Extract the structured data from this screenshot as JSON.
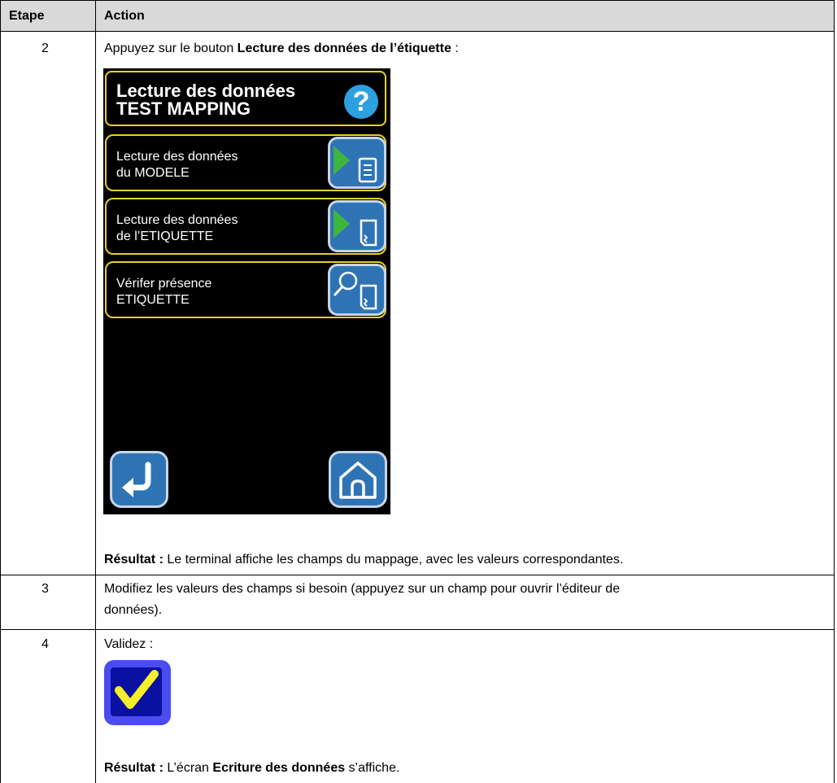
{
  "table": {
    "headers": [
      "Etape",
      "Action"
    ],
    "rows": [
      {
        "step": "2",
        "instruction_prefix": "Appuyez sur le bouton ",
        "instruction_bold": "Lecture des données de l’étiquette",
        "instruction_suffix": " :",
        "result_label": "Résultat :",
        "result_text": " Le terminal affiche les champs du mappage, avec les valeurs correspondantes."
      },
      {
        "step": "3",
        "line1": "Modifiez les valeurs des champs si besoin (appuyez sur un champ pour ouvrir l’éditeur de",
        "line2": "données)."
      },
      {
        "step": "4",
        "instruction": "Validez :",
        "result_label": "Résultat :",
        "result_prefix": " L’écran ",
        "result_bold": "Ecriture des données",
        "result_suffix": " s’affiche."
      }
    ]
  },
  "device": {
    "title_line1": "Lecture des données",
    "title_line2": "TEST MAPPING",
    "help_symbol": "?",
    "menu": [
      {
        "line1": "Lecture des données",
        "line2": "du MODELE",
        "icon": "read-model-icon"
      },
      {
        "line1": "Lecture des données",
        "line2": "de l’ETIQUETTE",
        "icon": "read-tag-icon"
      },
      {
        "line1": "Vérifer présence",
        "line2": "ETIQUETTE",
        "icon": "check-tag-presence-icon"
      }
    ],
    "nav": {
      "back_icon": "back-arrow-icon",
      "home_icon": "home-icon"
    },
    "colors": {
      "frame": "#e8d21a",
      "button": "#2e74b5",
      "play": "#3fb43f",
      "help": "#2da0e0"
    }
  },
  "validate_icon": {
    "name": "validate-check-icon",
    "colors": {
      "outer": "#4a4cf0",
      "inner": "#0a10a0",
      "check": "#f5ef2a"
    }
  }
}
